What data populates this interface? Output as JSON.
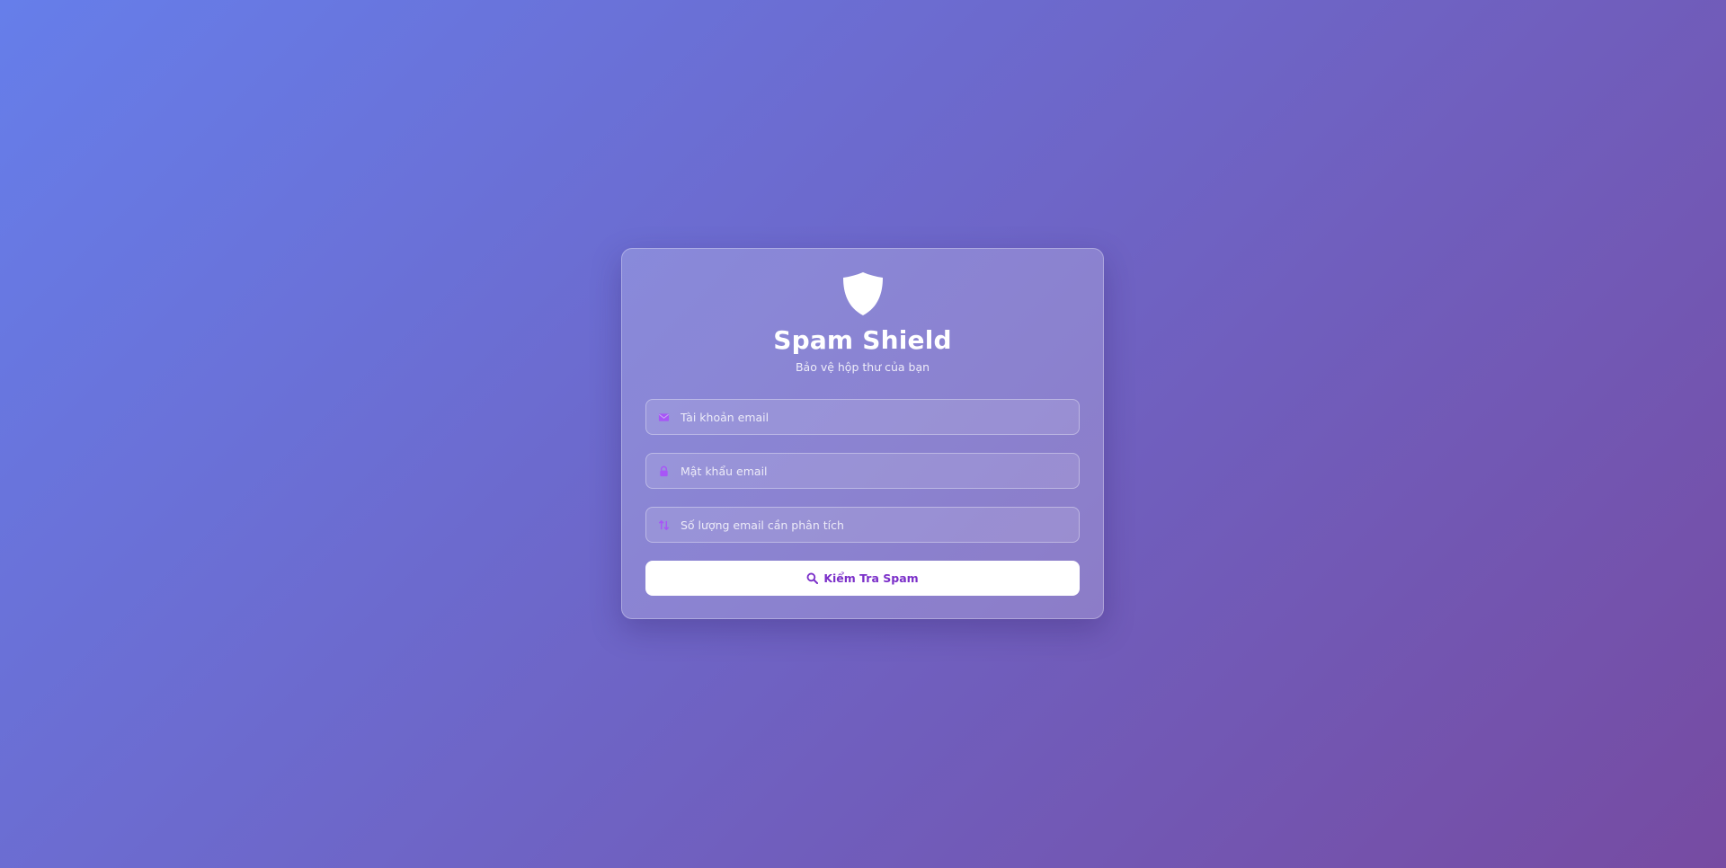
{
  "app": {
    "title": "Spam Shield",
    "subtitle": "Bảo vệ hộp thư của bạn",
    "logo_icon": "shield-icon"
  },
  "form": {
    "email": {
      "placeholder": "Tài khoản email",
      "value": "",
      "icon": "envelope-icon"
    },
    "password": {
      "placeholder": "Mật khẩu email",
      "value": "",
      "icon": "lock-icon"
    },
    "count": {
      "placeholder": "Số lượng email cần phân tích",
      "value": "",
      "icon": "sort-arrows-icon"
    },
    "submit": {
      "label": "Kiểm Tra Spam",
      "icon": "search-icon"
    }
  },
  "colors": {
    "bg_start": "#667eea",
    "bg_end": "#764ba2",
    "accent": "#7b2fc9",
    "icon_purple": "#a855f7"
  }
}
